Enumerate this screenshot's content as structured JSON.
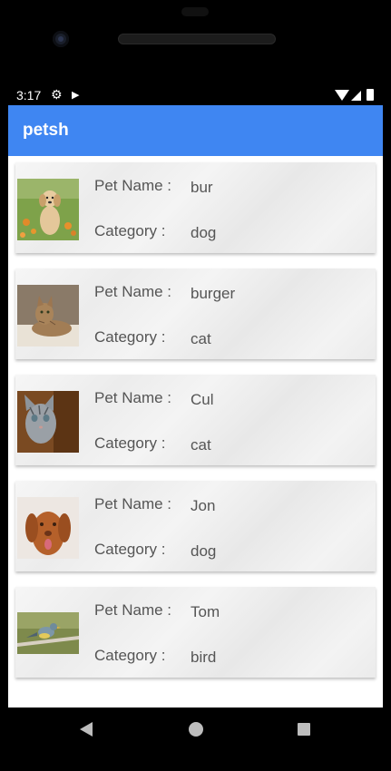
{
  "status_bar": {
    "time": "3:17"
  },
  "app_bar": {
    "title": "petsh",
    "color": "#3f86f2"
  },
  "labels": {
    "pet_name": "Pet Name :",
    "category": "Category :"
  },
  "pets": [
    {
      "name": "bur",
      "category": "dog",
      "photo": "golden-puppy-photo"
    },
    {
      "name": "burger",
      "category": "cat",
      "photo": "tabby-cat-photo"
    },
    {
      "name": "Cul",
      "category": "cat",
      "photo": "kitten-photo"
    },
    {
      "name": "Jon",
      "category": "dog",
      "photo": "brown-dog-photo"
    },
    {
      "name": "Tom",
      "category": "bird",
      "photo": "bird-on-branch-photo"
    }
  ],
  "icons": {
    "settings": "gear-icon",
    "cast": "play-icon",
    "wifi": "wifi-icon",
    "signal": "signal-icon",
    "battery": "battery-icon",
    "back": "back-icon",
    "home": "home-icon",
    "recents": "recents-icon"
  }
}
